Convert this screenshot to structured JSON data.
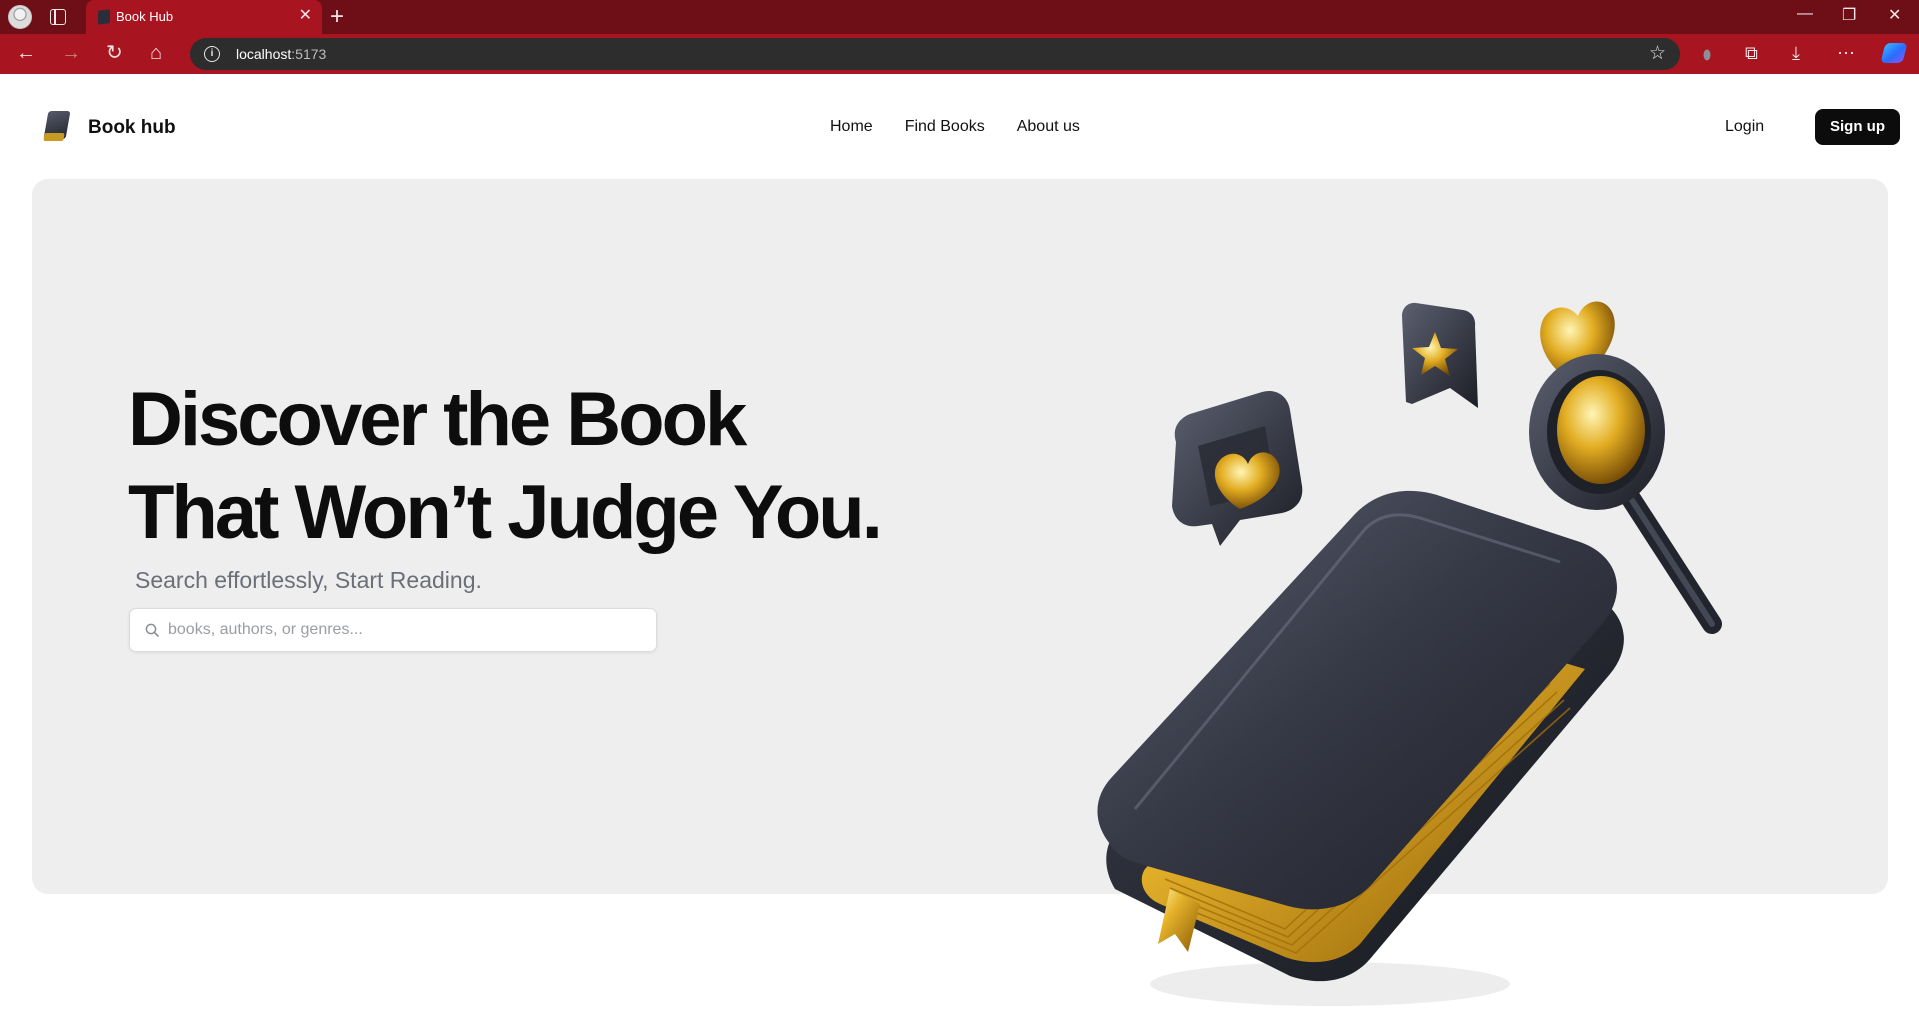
{
  "browser": {
    "tab": {
      "title": "Book Hub",
      "close": "✕"
    },
    "new_tab": "+",
    "window": {
      "minimize": "—",
      "restore": "❐",
      "close": "✕"
    },
    "nav": {
      "back": "←",
      "forward": "→",
      "reload": "↻",
      "home": "⌂"
    },
    "url": {
      "info": "i",
      "host": "localhost",
      "port": ":5173",
      "star": "☆"
    },
    "tools": {
      "extensions": "⧉",
      "downloads": "⤓",
      "more": "⋯"
    }
  },
  "header": {
    "brand": "Book hub",
    "nav": [
      "Home",
      "Find Books",
      "About us"
    ],
    "login": "Login",
    "signup": "Sign up"
  },
  "hero": {
    "headline_line1": "Discover the Book",
    "headline_line2": "That Won’t Judge You.",
    "subheadline": "Search effortlessly, Start Reading.",
    "search_placeholder": "books, authors, or genres..."
  },
  "colors": {
    "tabbar": "#6e0f17",
    "toolbar": "#a8141f",
    "hero_bg": "#eeeeee",
    "accent_gold": "#d9a21c",
    "book_dark": "#2b2e3a"
  }
}
